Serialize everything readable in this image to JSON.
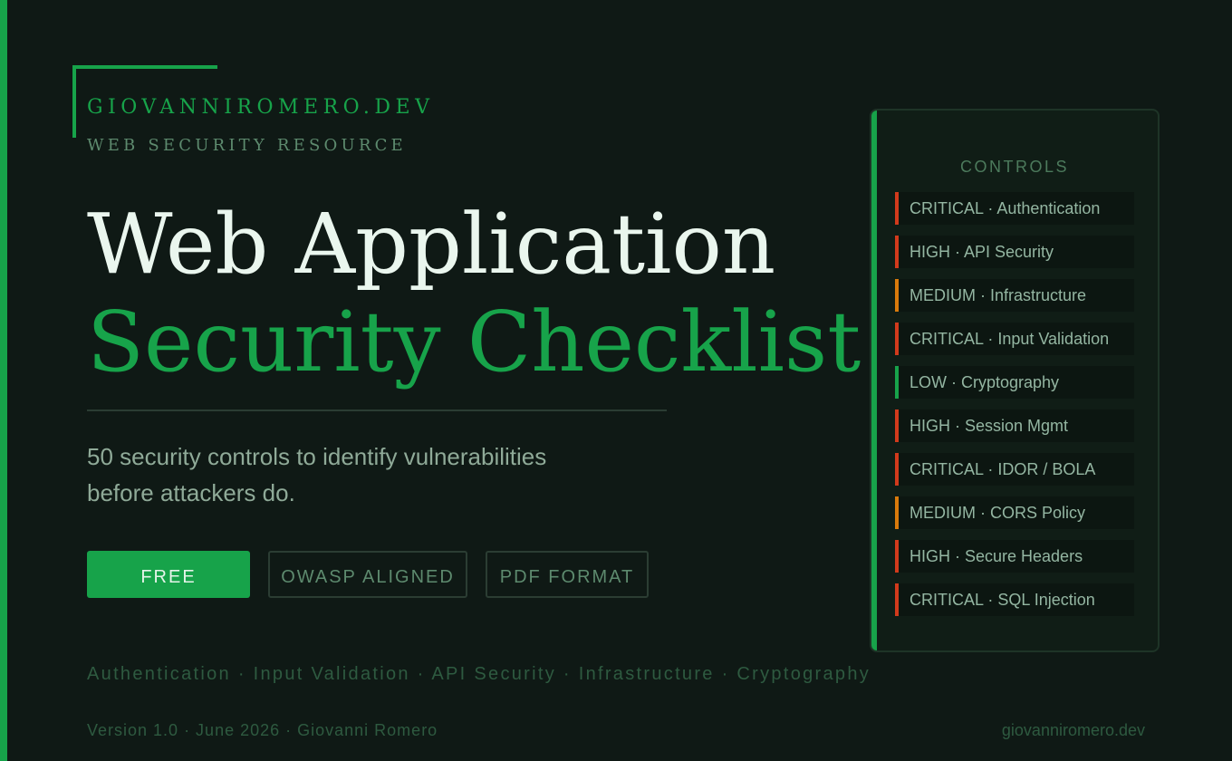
{
  "brand": {
    "site": "GIOVANNIROMERO.DEV",
    "subtitle": "WEB SECURITY RESOURCE"
  },
  "hero": {
    "title_line1": "Web Application",
    "title_line2": "Security Checklist",
    "tagline_line1": "50 security controls to identify vulnerabilities",
    "tagline_line2": "before attackers do."
  },
  "badges": {
    "free": "FREE",
    "owasp": "OWASP ALIGNED",
    "pdf": "PDF FORMAT"
  },
  "topics": "Authentication · Input Validation · API Security · Infrastructure · Cryptography",
  "footer": {
    "version": "Version 1.0 · June 2026 · Giovanni Romero",
    "domain": "giovanniromero.dev"
  },
  "controls_panel": {
    "title": "CONTROLS",
    "items": [
      {
        "label": "CRITICAL · Authentication",
        "severity": "critical"
      },
      {
        "label": "HIGH · API Security",
        "severity": "high"
      },
      {
        "label": "MEDIUM · Infrastructure",
        "severity": "medium"
      },
      {
        "label": "CRITICAL · Input Validation",
        "severity": "critical"
      },
      {
        "label": "LOW · Cryptography",
        "severity": "low"
      },
      {
        "label": "HIGH · Session Mgmt",
        "severity": "high"
      },
      {
        "label": "CRITICAL · IDOR / BOLA",
        "severity": "critical"
      },
      {
        "label": "MEDIUM · CORS Policy",
        "severity": "medium"
      },
      {
        "label": "HIGH · Secure Headers",
        "severity": "high"
      },
      {
        "label": "CRITICAL · SQL Injection",
        "severity": "critical"
      }
    ]
  },
  "colors": {
    "accent": "#17a34a",
    "critical": "#d23a1c",
    "high": "#d23a1c",
    "medium": "#d97a0b",
    "low": "#17a34a"
  }
}
